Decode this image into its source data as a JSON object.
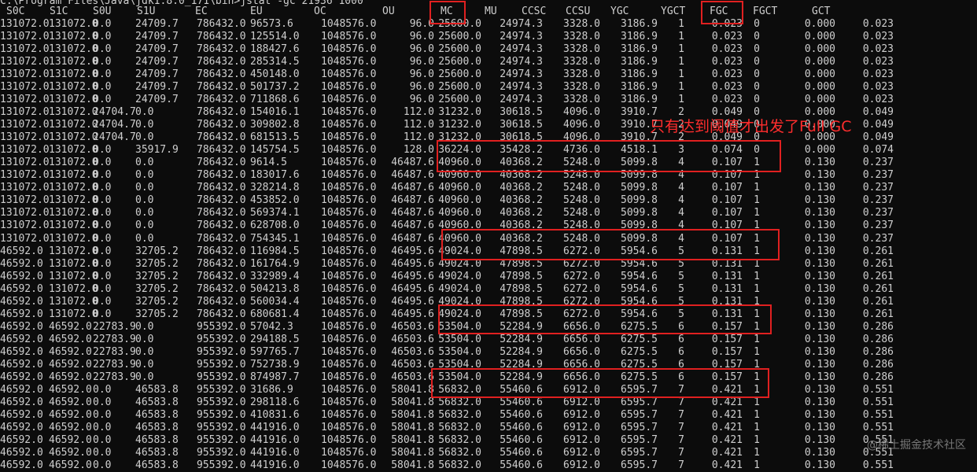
{
  "command": "C:\\Program Files\\Java\\jdk1.8.0_171\\bin>jstat -gc 21936 1000",
  "headers": [
    "S0C",
    "S1C",
    "S0U",
    "S1U",
    "EC",
    "EU",
    "OC",
    "OU",
    "MC",
    "MU",
    "CCSC",
    "CCSU",
    "YGC",
    "YGCT",
    "FGC",
    "FGCT",
    "GCT"
  ],
  "rows": [
    [
      "131072.0",
      "131072.0",
      "0.0",
      "24709.7",
      "786432.0",
      "96573.6",
      "1048576.0",
      "96.0",
      "25600.0",
      "24974.3",
      "3328.0",
      "3186.9",
      "1",
      "0.023",
      "0",
      "0.000",
      "0.023"
    ],
    [
      "131072.0",
      "131072.0",
      "0.0",
      "24709.7",
      "786432.0",
      "125514.0",
      "1048576.0",
      "96.0",
      "25600.0",
      "24974.3",
      "3328.0",
      "3186.9",
      "1",
      "0.023",
      "0",
      "0.000",
      "0.023"
    ],
    [
      "131072.0",
      "131072.0",
      "0.0",
      "24709.7",
      "786432.0",
      "188427.6",
      "1048576.0",
      "96.0",
      "25600.0",
      "24974.3",
      "3328.0",
      "3186.9",
      "1",
      "0.023",
      "0",
      "0.000",
      "0.023"
    ],
    [
      "131072.0",
      "131072.0",
      "0.0",
      "24709.7",
      "786432.0",
      "285314.5",
      "1048576.0",
      "96.0",
      "25600.0",
      "24974.3",
      "3328.0",
      "3186.9",
      "1",
      "0.023",
      "0",
      "0.000",
      "0.023"
    ],
    [
      "131072.0",
      "131072.0",
      "0.0",
      "24709.7",
      "786432.0",
      "450148.0",
      "1048576.0",
      "96.0",
      "25600.0",
      "24974.3",
      "3328.0",
      "3186.9",
      "1",
      "0.023",
      "0",
      "0.000",
      "0.023"
    ],
    [
      "131072.0",
      "131072.0",
      "0.0",
      "24709.7",
      "786432.0",
      "501737.2",
      "1048576.0",
      "96.0",
      "25600.0",
      "24974.3",
      "3328.0",
      "3186.9",
      "1",
      "0.023",
      "0",
      "0.000",
      "0.023"
    ],
    [
      "131072.0",
      "131072.0",
      "0.0",
      "24709.7",
      "786432.0",
      "711868.6",
      "1048576.0",
      "96.0",
      "25600.0",
      "24974.3",
      "3328.0",
      "3186.9",
      "1",
      "0.023",
      "0",
      "0.000",
      "0.023"
    ],
    [
      "131072.0",
      "131072.0",
      "24704.7",
      "0.0",
      "786432.0",
      "154016.1",
      "1048576.0",
      "112.0",
      "31232.0",
      "30618.5",
      "4096.0",
      "3910.7",
      "2",
      "0.049",
      "0",
      "0.000",
      "0.049"
    ],
    [
      "131072.0",
      "131072.0",
      "24704.7",
      "0.0",
      "786432.0",
      "309802.8",
      "1048576.0",
      "112.0",
      "31232.0",
      "30618.5",
      "4096.0",
      "3910.7",
      "2",
      "0.049",
      "0",
      "0.000",
      "0.049"
    ],
    [
      "131072.0",
      "131072.0",
      "24704.7",
      "0.0",
      "786432.0",
      "681513.5",
      "1048576.0",
      "112.0",
      "31232.0",
      "30618.5",
      "4096.0",
      "3910.7",
      "2",
      "0.049",
      "0",
      "0.000",
      "0.049"
    ],
    [
      "131072.0",
      "131072.0",
      "0.0",
      "35917.9",
      "786432.0",
      "145754.5",
      "1048576.0",
      "128.0",
      "36224.0",
      "35428.2",
      "4736.0",
      "4518.1",
      "3",
      "0.074",
      "0",
      "0.000",
      "0.074"
    ],
    [
      "131072.0",
      "131072.0",
      "0.0",
      "0.0",
      "786432.0",
      "9614.5",
      "1048576.0",
      "46487.6",
      "40960.0",
      "40368.2",
      "5248.0",
      "5099.8",
      "4",
      "0.107",
      "1",
      "0.130",
      "0.237"
    ],
    [
      "131072.0",
      "131072.0",
      "0.0",
      "0.0",
      "786432.0",
      "183017.6",
      "1048576.0",
      "46487.6",
      "40960.0",
      "40368.2",
      "5248.0",
      "5099.8",
      "4",
      "0.107",
      "1",
      "0.130",
      "0.237"
    ],
    [
      "131072.0",
      "131072.0",
      "0.0",
      "0.0",
      "786432.0",
      "328214.8",
      "1048576.0",
      "46487.6",
      "40960.0",
      "40368.2",
      "5248.0",
      "5099.8",
      "4",
      "0.107",
      "1",
      "0.130",
      "0.237"
    ],
    [
      "131072.0",
      "131072.0",
      "0.0",
      "0.0",
      "786432.0",
      "453852.0",
      "1048576.0",
      "46487.6",
      "40960.0",
      "40368.2",
      "5248.0",
      "5099.8",
      "4",
      "0.107",
      "1",
      "0.130",
      "0.237"
    ],
    [
      "131072.0",
      "131072.0",
      "0.0",
      "0.0",
      "786432.0",
      "569374.1",
      "1048576.0",
      "46487.6",
      "40960.0",
      "40368.2",
      "5248.0",
      "5099.8",
      "4",
      "0.107",
      "1",
      "0.130",
      "0.237"
    ],
    [
      "131072.0",
      "131072.0",
      "0.0",
      "0.0",
      "786432.0",
      "628708.0",
      "1048576.0",
      "46487.6",
      "40960.0",
      "40368.2",
      "5248.0",
      "5099.8",
      "4",
      "0.107",
      "1",
      "0.130",
      "0.237"
    ],
    [
      "131072.0",
      "131072.0",
      "0.0",
      "0.0",
      "786432.0",
      "754345.1",
      "1048576.0",
      "46487.6",
      "40960.0",
      "40368.2",
      "5248.0",
      "5099.8",
      "4",
      "0.107",
      "1",
      "0.130",
      "0.237"
    ],
    [
      "46592.0",
      "131072.0",
      "0.0",
      "32705.2",
      "786432.0",
      "116984.5",
      "1048576.0",
      "46495.6",
      "49024.0",
      "47898.5",
      "6272.0",
      "5954.6",
      "5",
      "0.131",
      "1",
      "0.130",
      "0.261"
    ],
    [
      "46592.0",
      "131072.0",
      "0.0",
      "32705.2",
      "786432.0",
      "161764.9",
      "1048576.0",
      "46495.6",
      "49024.0",
      "47898.5",
      "6272.0",
      "5954.6",
      "5",
      "0.131",
      "1",
      "0.130",
      "0.261"
    ],
    [
      "46592.0",
      "131072.0",
      "0.0",
      "32705.2",
      "786432.0",
      "332989.4",
      "1048576.0",
      "46495.6",
      "49024.0",
      "47898.5",
      "6272.0",
      "5954.6",
      "5",
      "0.131",
      "1",
      "0.130",
      "0.261"
    ],
    [
      "46592.0",
      "131072.0",
      "0.0",
      "32705.2",
      "786432.0",
      "504213.8",
      "1048576.0",
      "46495.6",
      "49024.0",
      "47898.5",
      "6272.0",
      "5954.6",
      "5",
      "0.131",
      "1",
      "0.130",
      "0.261"
    ],
    [
      "46592.0",
      "131072.0",
      "0.0",
      "32705.2",
      "786432.0",
      "560034.4",
      "1048576.0",
      "46495.6",
      "49024.0",
      "47898.5",
      "6272.0",
      "5954.6",
      "5",
      "0.131",
      "1",
      "0.130",
      "0.261"
    ],
    [
      "46592.0",
      "131072.0",
      "0.0",
      "32705.2",
      "786432.0",
      "680681.4",
      "1048576.0",
      "46495.6",
      "49024.0",
      "47898.5",
      "6272.0",
      "5954.6",
      "5",
      "0.131",
      "1",
      "0.130",
      "0.261"
    ],
    [
      "46592.0",
      "46592.0",
      "22783.9",
      "0.0",
      "955392.0",
      "57042.3",
      "1048576.0",
      "46503.6",
      "53504.0",
      "52284.9",
      "6656.0",
      "6275.5",
      "6",
      "0.157",
      "1",
      "0.130",
      "0.286"
    ],
    [
      "46592.0",
      "46592.0",
      "22783.9",
      "0.0",
      "955392.0",
      "294188.5",
      "1048576.0",
      "46503.6",
      "53504.0",
      "52284.9",
      "6656.0",
      "6275.5",
      "6",
      "0.157",
      "1",
      "0.130",
      "0.286"
    ],
    [
      "46592.0",
      "46592.0",
      "22783.9",
      "0.0",
      "955392.0",
      "597765.7",
      "1048576.0",
      "46503.6",
      "53504.0",
      "52284.9",
      "6656.0",
      "6275.5",
      "6",
      "0.157",
      "1",
      "0.130",
      "0.286"
    ],
    [
      "46592.0",
      "46592.0",
      "22783.9",
      "0.0",
      "955392.0",
      "752738.9",
      "1048576.0",
      "46503.6",
      "53504.0",
      "52284.9",
      "6656.0",
      "6275.5",
      "6",
      "0.157",
      "1",
      "0.130",
      "0.286"
    ],
    [
      "46592.0",
      "46592.0",
      "22783.9",
      "0.0",
      "955392.0",
      "874987.7",
      "1048576.0",
      "46503.6",
      "53504.0",
      "52284.9",
      "6656.0",
      "6275.5",
      "6",
      "0.157",
      "1",
      "0.130",
      "0.286"
    ],
    [
      "46592.0",
      "46592.0",
      "0.0",
      "46583.8",
      "955392.0",
      "31686.9",
      "1048576.0",
      "58041.8",
      "56832.0",
      "55460.6",
      "6912.0",
      "6595.7",
      "7",
      "0.421",
      "1",
      "0.130",
      "0.551"
    ],
    [
      "46592.0",
      "46592.0",
      "0.0",
      "46583.8",
      "955392.0",
      "298118.6",
      "1048576.0",
      "58041.8",
      "56832.0",
      "55460.6",
      "6912.0",
      "6595.7",
      "7",
      "0.421",
      "1",
      "0.130",
      "0.551"
    ],
    [
      "46592.0",
      "46592.0",
      "0.0",
      "46583.8",
      "955392.0",
      "410831.6",
      "1048576.0",
      "58041.8",
      "56832.0",
      "55460.6",
      "6912.0",
      "6595.7",
      "7",
      "0.421",
      "1",
      "0.130",
      "0.551"
    ],
    [
      "46592.0",
      "46592.0",
      "0.0",
      "46583.8",
      "955392.0",
      "441916.0",
      "1048576.0",
      "58041.8",
      "56832.0",
      "55460.6",
      "6912.0",
      "6595.7",
      "7",
      "0.421",
      "1",
      "0.130",
      "0.551"
    ],
    [
      "46592.0",
      "46592.0",
      "0.0",
      "46583.8",
      "955392.0",
      "441916.0",
      "1048576.0",
      "58041.8",
      "56832.0",
      "55460.6",
      "6912.0",
      "6595.7",
      "7",
      "0.421",
      "1",
      "0.130",
      "0.551"
    ],
    [
      "46592.0",
      "46592.0",
      "0.0",
      "46583.8",
      "955392.0",
      "441916.0",
      "1048576.0",
      "58041.8",
      "56832.0",
      "55460.6",
      "6912.0",
      "6595.7",
      "7",
      "0.421",
      "1",
      "0.130",
      "0.551"
    ],
    [
      "46592.0",
      "46592.0",
      "0.0",
      "46583.8",
      "955392.0",
      "441916.0",
      "1048576.0",
      "58041.8",
      "56832.0",
      "55460.6",
      "6912.0",
      "6595.7",
      "7",
      "0.421",
      "1",
      "0.130",
      "0.551"
    ]
  ],
  "annotation_text": "只有达到阈值才出发了Full GC",
  "watermark": "@稀土掘金技术社区",
  "colors": {
    "background": "#0c0c0c",
    "text": "#cfcfcf",
    "highlight": "#e02020"
  }
}
